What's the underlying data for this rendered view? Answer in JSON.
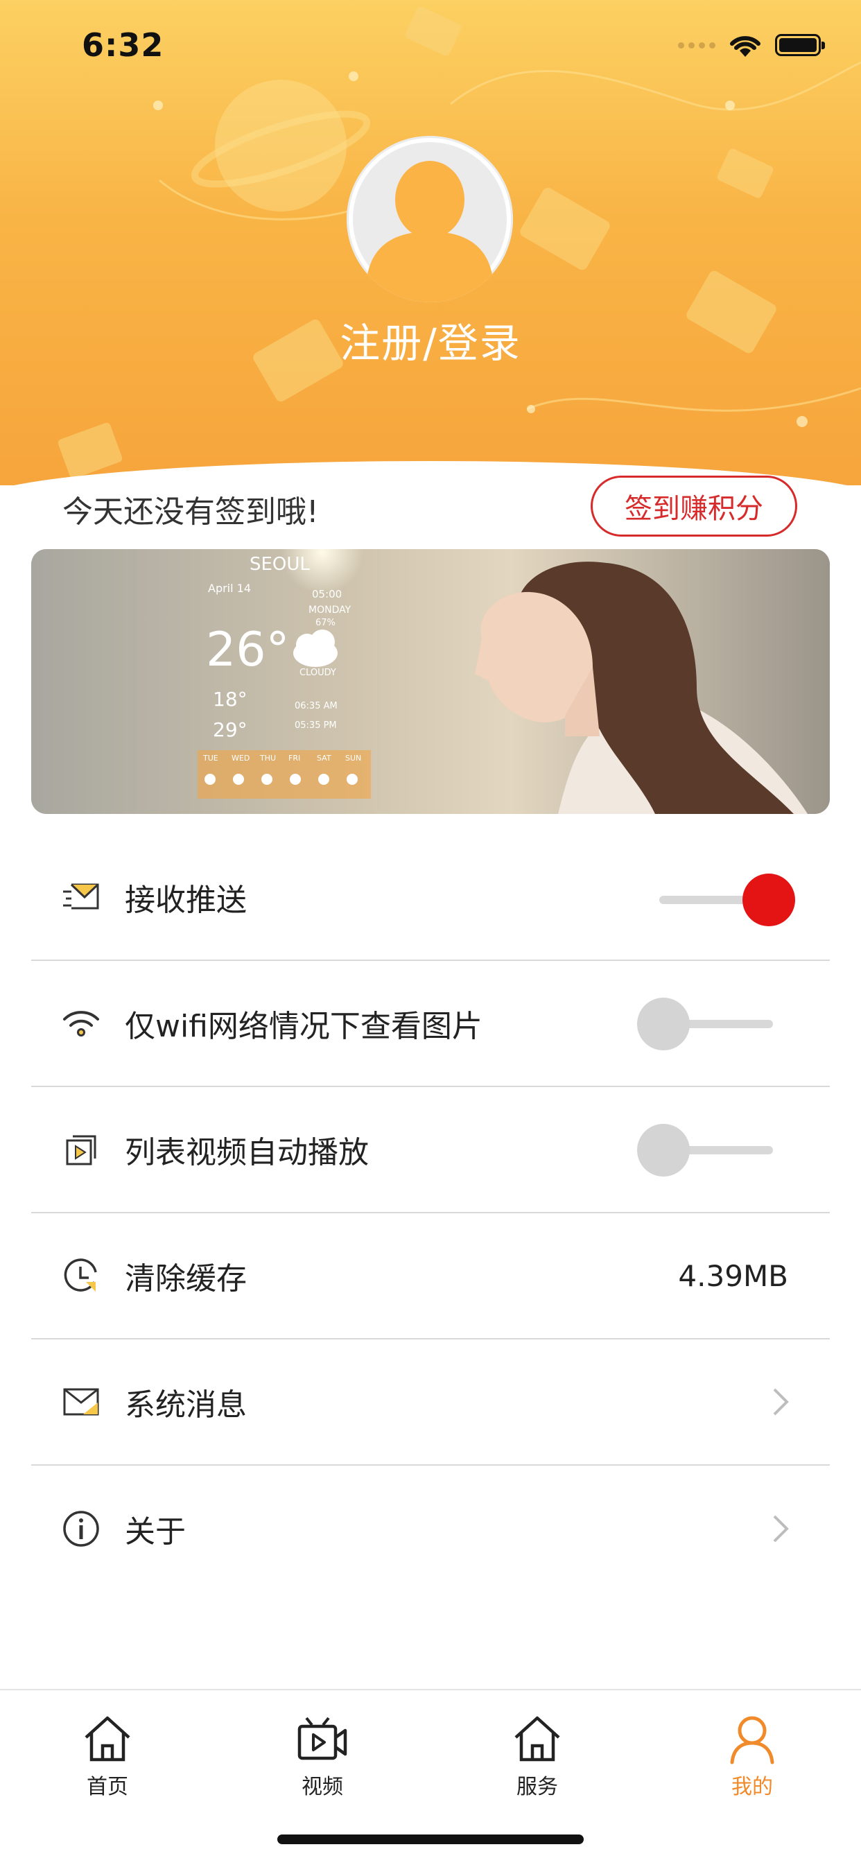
{
  "status_bar": {
    "time": "6:32"
  },
  "profile": {
    "login_text": "注册/登录"
  },
  "checkin": {
    "message": "今天还没有签到哦!",
    "button_label": "签到赚积分"
  },
  "banner": {
    "weather": {
      "city": "SEOUL",
      "date": "April 14",
      "time": "05:00",
      "day": "MONDAY",
      "humidity": "67%",
      "temperature": "26°",
      "condition": "CLOUDY",
      "low": "18°",
      "high": "29°",
      "sunrise": "06:35 AM",
      "sunset": "05:35 PM",
      "forecast_days": [
        "TUE",
        "WED",
        "THU",
        "FRI",
        "SAT",
        "SUN"
      ]
    }
  },
  "settings": {
    "push": {
      "label": "接收推送",
      "icon": "envelope-push-icon",
      "enabled": true
    },
    "wifi_images": {
      "label": "仅wifi网络情况下查看图片",
      "icon": "wifi-icon",
      "enabled": false
    },
    "autoplay": {
      "label": "列表视频自动播放",
      "icon": "video-play-icon",
      "enabled": false
    },
    "cache": {
      "label": "清除缓存",
      "icon": "clock-icon",
      "value": "4.39MB"
    },
    "messages": {
      "label": "系统消息",
      "icon": "mail-icon"
    },
    "about": {
      "label": "关于",
      "icon": "info-icon"
    }
  },
  "tabbar": {
    "tabs": [
      {
        "label": "首页",
        "icon": "home-icon",
        "active": false
      },
      {
        "label": "视频",
        "icon": "tv-icon",
        "active": false
      },
      {
        "label": "服务",
        "icon": "home-icon",
        "active": false
      },
      {
        "label": "我的",
        "icon": "person-icon",
        "active": true
      }
    ]
  },
  "colors": {
    "accent": "#f08a2a",
    "toggle_on": "#e51414",
    "checkin_border": "#d72a2a",
    "header_top": "#fcd062",
    "header_bottom": "#f6a53c"
  }
}
